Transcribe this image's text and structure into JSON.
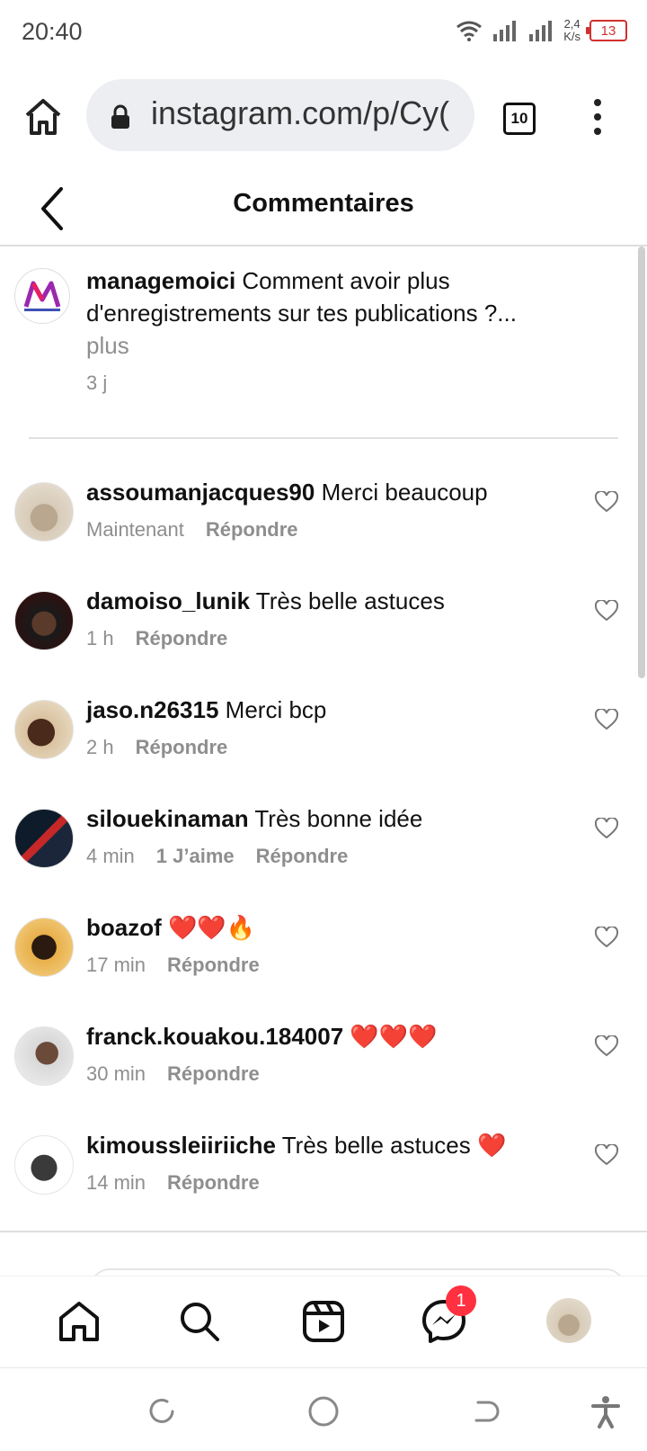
{
  "status_bar": {
    "time": "20:40",
    "speed": "2,4",
    "speed_unit": "K/s",
    "battery": "13"
  },
  "browser": {
    "url": "instagram.com/p/Cy(",
    "tab_count": "10"
  },
  "header": {
    "title": "Commentaires"
  },
  "caption": {
    "username": "managemoici",
    "text": " Comment avoir plus d'enregistrements sur tes publications ?...",
    "more": "plus",
    "time": "3 j"
  },
  "comments": [
    {
      "username": "assoumanjacques90",
      "text": " Merci beaucoup",
      "time": "Maintenant",
      "likes": "",
      "reply": "Répondre"
    },
    {
      "username": "damoiso_lunik",
      "text": " Très belle astuces",
      "time": "1 h",
      "likes": "",
      "reply": "Répondre"
    },
    {
      "username": "jaso.n26315",
      "text": " Merci bcp",
      "time": "2 h",
      "likes": "",
      "reply": "Répondre"
    },
    {
      "username": "silouekinaman",
      "text": " Très bonne idée",
      "time": "4 min",
      "likes": "1 J’aime",
      "reply": "Répondre"
    },
    {
      "username": "boazof",
      "text": " ❤️❤️🔥",
      "time": "17 min",
      "likes": "",
      "reply": "Répondre"
    },
    {
      "username": "franck.kouakou.184007",
      "text": " ❤️❤️❤️",
      "time": "30 min",
      "likes": "",
      "reply": "Répondre"
    },
    {
      "username": "kimoussleiiriiche",
      "text": " Très belle astuces ❤️",
      "time": "14 min",
      "likes": "",
      "reply": "Répondre"
    }
  ],
  "nav": {
    "messages_badge": "1"
  },
  "colors": {
    "badge": "#ff3040",
    "secondary_text": "#8e8e8e",
    "battery_warn": "#d32f2f"
  },
  "icons": [
    "home-icon",
    "lock-icon",
    "tabs-icon",
    "more-vert-icon",
    "back-arrow-icon",
    "heart-icon",
    "search-icon",
    "reels-icon",
    "messenger-icon",
    "profile-avatar",
    "recents-icon",
    "circle-home-icon",
    "back-nav-icon",
    "accessibility-icon"
  ]
}
